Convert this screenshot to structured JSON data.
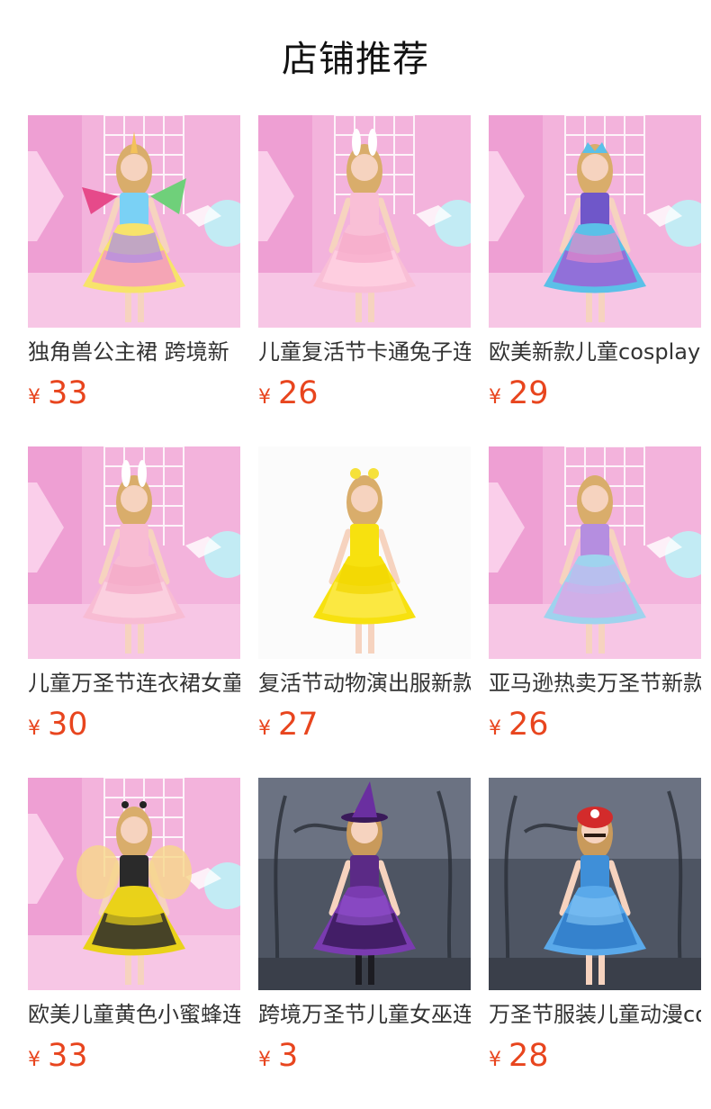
{
  "header": {
    "title": "店铺推荐"
  },
  "currency_symbol": "¥",
  "theme": {
    "price_color": "#e8451e"
  },
  "products": [
    {
      "name": "独角兽公主裙 跨境新",
      "price": "33",
      "scene": "pink-room",
      "dress": [
        "#7ad1f5",
        "#f7e36b",
        "#f59ac2",
        "#a98be8"
      ],
      "accessory": "unicorn-wings"
    },
    {
      "name": "儿童复活节卡通兔子连",
      "price": "26",
      "scene": "pink-room",
      "dress": [
        "#f9bfd6",
        "#f9bfd6",
        "#ffd0e2",
        "#f7a9c9"
      ],
      "accessory": "bunny-ears"
    },
    {
      "name": "欧美新款儿童cosplay",
      "price": "29",
      "scene": "pink-room",
      "dress": [
        "#6f57c9",
        "#5bc0e8",
        "#9b62d6",
        "#e489c9"
      ],
      "accessory": "mermaid-crown"
    },
    {
      "name": "儿童万圣节连衣裙女童",
      "price": "30",
      "scene": "pink-room",
      "dress": [
        "#f8bcd3",
        "#f8bcd3",
        "#fcd2e1",
        "#f3a8c6"
      ],
      "accessory": "bunny-ears"
    },
    {
      "name": "复活节动物演出服新款",
      "price": "27",
      "scene": "white-studio",
      "dress": [
        "#f7e10f",
        "#f7e10f",
        "#fbe94a",
        "#f1d600"
      ],
      "accessory": "chick-headband"
    },
    {
      "name": "亚马逊热卖万圣节新款",
      "price": "26",
      "scene": "pink-room",
      "dress": [
        "#b58ee0",
        "#9fd3ee",
        "#d8a8e6",
        "#c3b6ee"
      ],
      "accessory": "none"
    },
    {
      "name": "欧美儿童黄色小蜜蜂连",
      "price": "33",
      "scene": "pink-room",
      "dress": [
        "#2a2a2a",
        "#e9d21a",
        "#2a2a2a",
        "#e9d21a"
      ],
      "accessory": "bee-wings"
    },
    {
      "name": "跨境万圣节儿童女巫连",
      "price": "3",
      "scene": "dark-forest",
      "dress": [
        "#5b2a86",
        "#7a3bb0",
        "#3a1a5a",
        "#8f4fcb"
      ],
      "accessory": "witch-hat"
    },
    {
      "name": "万圣节服装儿童动漫cos",
      "price": "28",
      "scene": "dark-forest",
      "dress": [
        "#3f8fd8",
        "#5aa9ea",
        "#2f7bc8",
        "#7ec0f2"
      ],
      "accessory": "plumber-cap"
    }
  ]
}
